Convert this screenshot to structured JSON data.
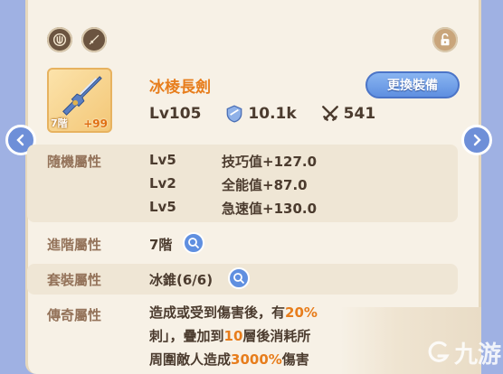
{
  "header": {
    "icons": [
      "shield-icon",
      "sword-icon",
      "lock-icon"
    ]
  },
  "item": {
    "tier": "7階",
    "plus": "+99",
    "name": "冰棱長劍",
    "level": "Lv105",
    "defense": "10.1k",
    "attack": "541",
    "swap_label": "更換裝備"
  },
  "random_attrs": {
    "label": "隨機屬性",
    "rows": [
      {
        "level": "Lv5",
        "stat": "技巧值+127.0"
      },
      {
        "level": "Lv2",
        "stat": "全能值+87.0"
      },
      {
        "level": "Lv5",
        "stat": "急速值+130.0"
      }
    ]
  },
  "advance_attrs": {
    "label": "進階屬性",
    "value": "7階"
  },
  "set_attrs": {
    "label": "套裝屬性",
    "value": "冰錐(6/6)"
  },
  "legend_attrs": {
    "label": "傳奇屬性",
    "line1_pre": "造成或受到傷害後，有",
    "line1_hl": "20%",
    "line2_pre": "刺」，疊加到",
    "line2_hl": "10",
    "line2_post": "層後消耗所",
    "line3_pre": "周圍敵人造成",
    "line3_hl": "3000%",
    "line3_post": "傷害"
  },
  "watermark": {
    "text": "九游"
  },
  "colors": {
    "accent": "#e77d1c",
    "button": "#5f8fe0",
    "label": "#94735a",
    "text": "#4b3b2e"
  }
}
